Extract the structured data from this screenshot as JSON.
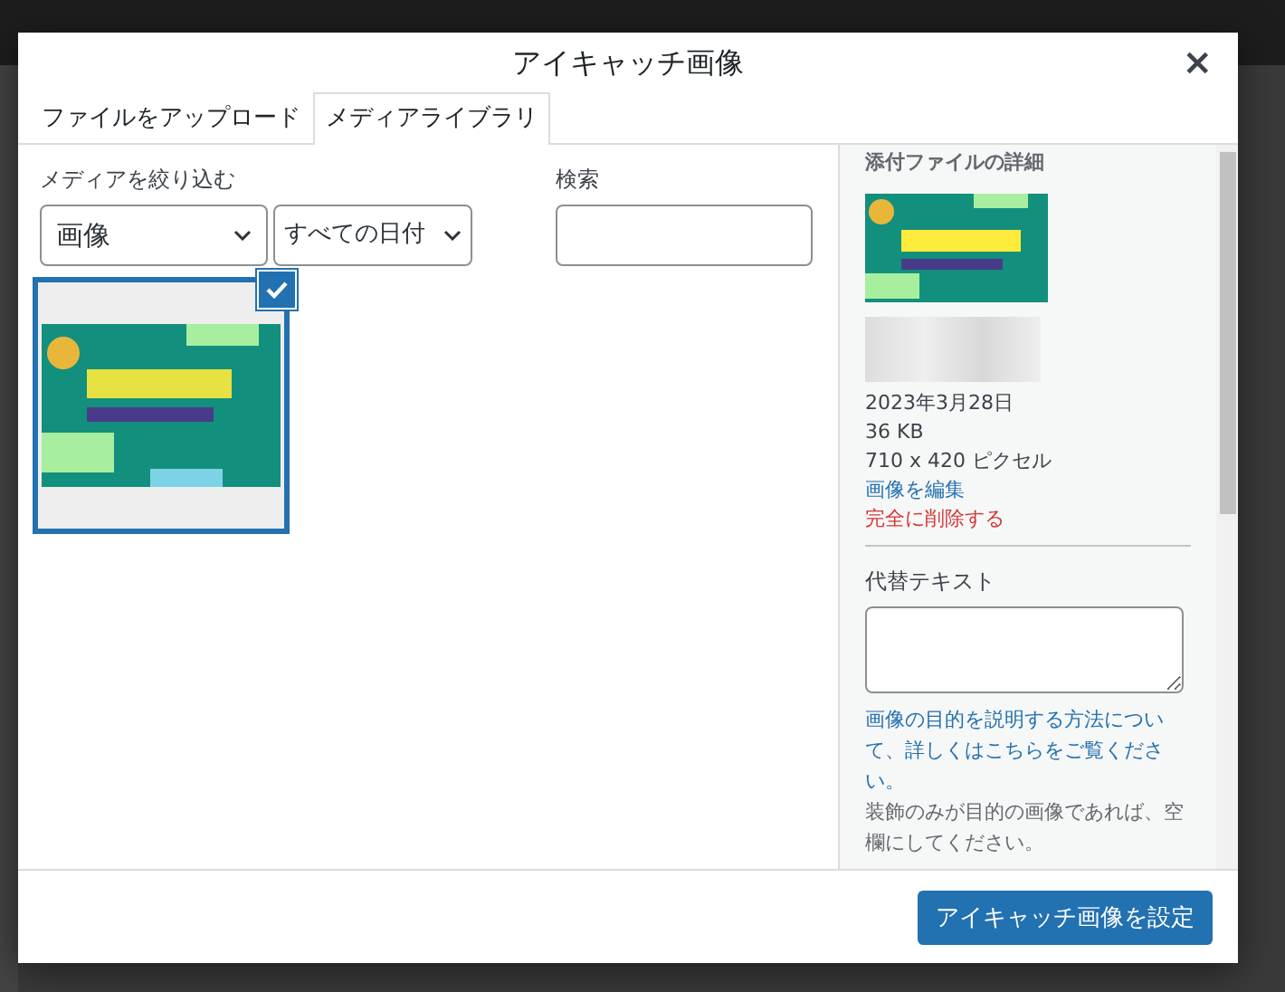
{
  "dialog": {
    "title": "アイキャッチ画像",
    "close": "×"
  },
  "tabs": [
    {
      "label": "ファイルをアップロード",
      "selected": false
    },
    {
      "label": "メディアライブラリ",
      "selected": true
    }
  ],
  "filter": {
    "label": "メディアを絞り込む",
    "type_select": "画像",
    "date_select": "すべての日付"
  },
  "search": {
    "label": "検索"
  },
  "media": [
    {
      "selected": true
    }
  ],
  "details": {
    "heading": "添付ファイルの詳細",
    "date": "2023年3月28日",
    "size": "36 KB",
    "dimensions": "710 x 420 ピクセル",
    "edit_link": "画像を編集",
    "delete_link": "完全に削除する",
    "alt_label": "代替テキスト",
    "alt_help_link": "画像の目的を説明する方法について、詳しくはこちらをご覧ください。",
    "alt_help_text": "装飾のみが目的の画像であれば、空欄にしてください。"
  },
  "footer": {
    "button": "アイキャッチ画像を設定"
  }
}
